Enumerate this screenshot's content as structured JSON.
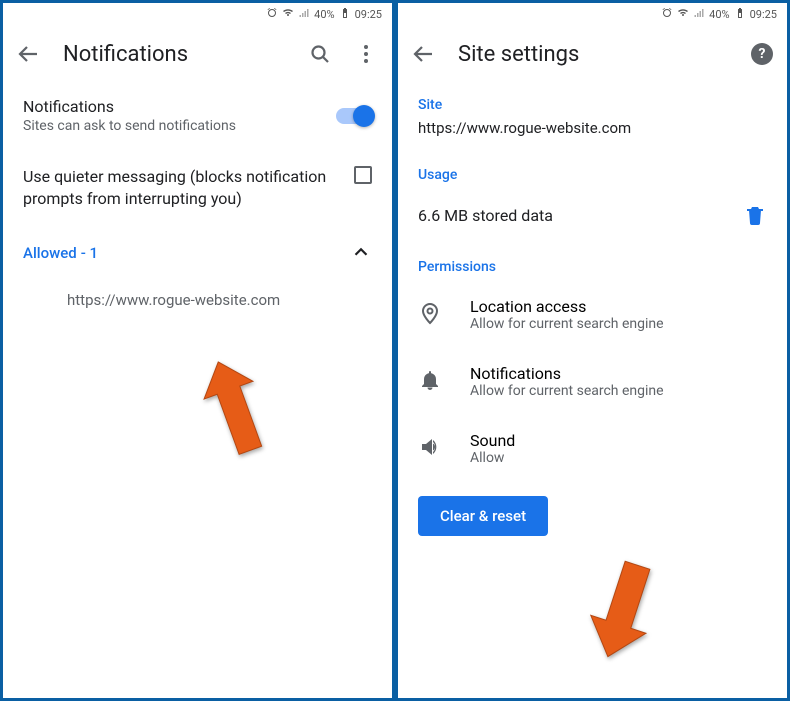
{
  "status": {
    "battery": "40%",
    "time": "09:25"
  },
  "left": {
    "title": "Notifications",
    "notif": {
      "primary": "Notifications",
      "secondary": "Sites can ask to send notifications"
    },
    "quieter": {
      "primary": "Use quieter messaging (blocks notification prompts from interrupting you)"
    },
    "allowed": {
      "label": "Allowed",
      "count": "- 1"
    },
    "site": "https://www.rogue-website.com"
  },
  "right": {
    "title": "Site settings",
    "sections": {
      "site": "Site",
      "usage": "Usage",
      "permissions": "Permissions"
    },
    "site_url": "https://www.rogue-website.com",
    "usage": {
      "text": "6.6 MB stored data"
    },
    "perm": {
      "location": {
        "primary": "Location access",
        "secondary": "Allow for current search engine"
      },
      "notif": {
        "primary": "Notifications",
        "secondary": "Allow for current search engine"
      },
      "sound": {
        "primary": "Sound",
        "secondary": "Allow"
      }
    },
    "clear_btn": "Clear & reset"
  }
}
